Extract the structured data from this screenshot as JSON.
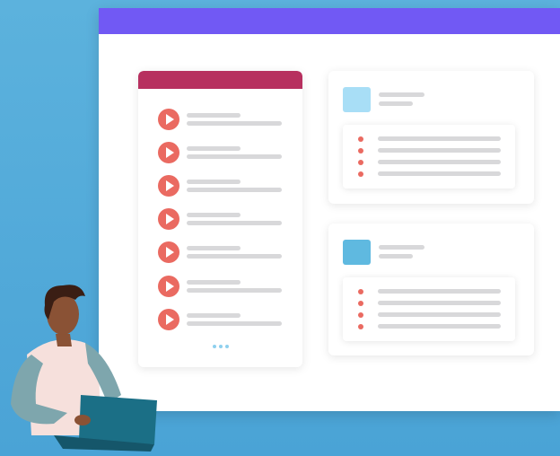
{
  "colors": {
    "background": "#55abdb",
    "window_bar": "#7159f4",
    "playlist_header": "#b7305f",
    "play_button": "#ea6a61",
    "placeholder_line": "#d8d8da",
    "thumb_light": "#a8def6",
    "thumb_dark": "#5fb9e0",
    "bullet": "#ea6a61",
    "laptop": "#1b6f86"
  },
  "icons": {
    "play": "play-icon",
    "more": "ellipsis-icon"
  },
  "playlist": {
    "item_count": 7
  },
  "panels": [
    {
      "thumb_color": "#a8def6",
      "bullet_count": 4
    },
    {
      "thumb_color": "#5fb9e0",
      "bullet_count": 4
    }
  ]
}
